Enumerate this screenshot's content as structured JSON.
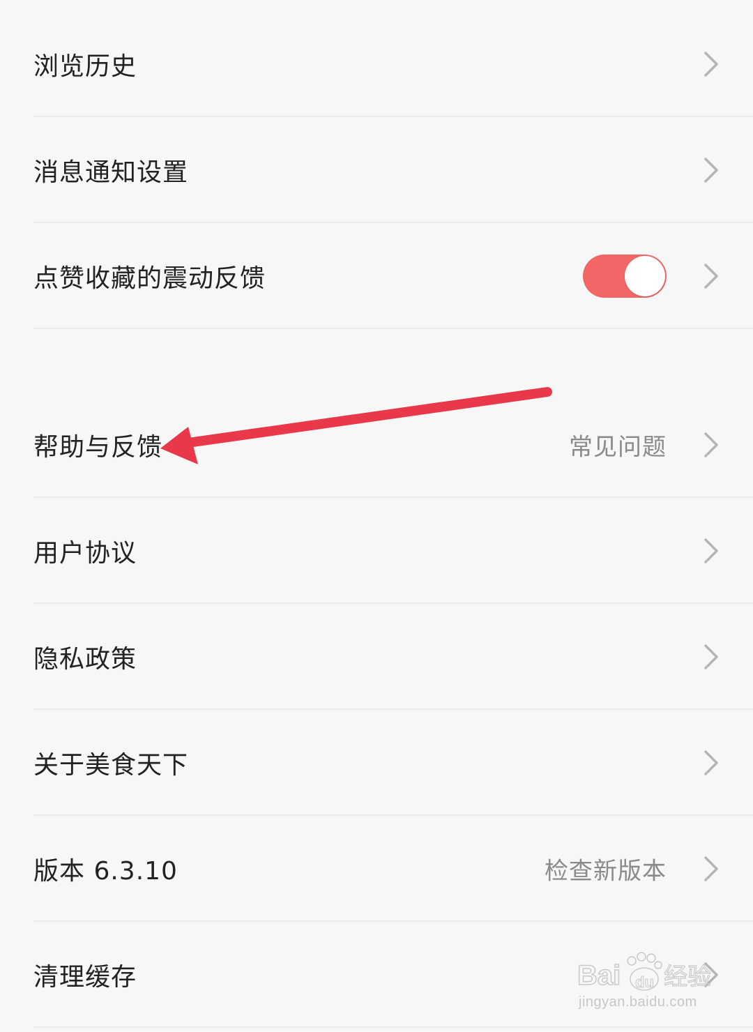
{
  "settings": {
    "items": [
      {
        "label": "浏览历史"
      },
      {
        "label": "消息通知设置"
      },
      {
        "label": "点赞收藏的震动反馈",
        "toggle_on": true
      },
      {
        "label": "帮助与反馈",
        "hint": "常见问题"
      },
      {
        "label": "用户协议"
      },
      {
        "label": "隐私政策"
      },
      {
        "label": "关于美食天下"
      },
      {
        "label": "版本 6.3.10",
        "hint": "检查新版本"
      },
      {
        "label": "清理缓存"
      }
    ]
  },
  "colors": {
    "toggle_on": "#f26666",
    "annotation_arrow": "#e8384a",
    "hint_text": "#8a8a8a"
  },
  "watermark": {
    "logo_text": "Bai",
    "logo_text2": "du",
    "logo_cn": "经验",
    "url": "jingyan.baidu.com"
  }
}
